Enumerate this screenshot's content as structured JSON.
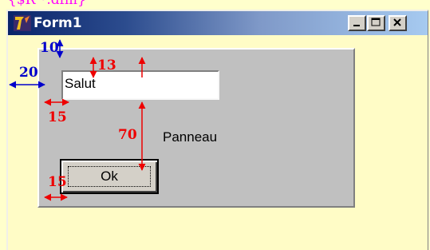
{
  "caption_top": "{$R *.dfm}",
  "window": {
    "title": "Form1",
    "icon": "delphi-app-icon",
    "controls": [
      "minimize-icon",
      "maximize-icon",
      "close-icon"
    ]
  },
  "edit": {
    "value": "Salut"
  },
  "panel": {
    "caption": "Panneau"
  },
  "ok_button": {
    "label": "Ok"
  },
  "dimensions": {
    "form_top": "10",
    "form_left": "20",
    "edit_top": "13",
    "edit_left": "15",
    "gap_edit_button": "70",
    "button_left": "15"
  },
  "colors": {
    "form_background": "#ffffcc",
    "panel_background": "#c0c0c0",
    "blue_annotation": "#0000cc",
    "red_annotation": "#ee0000"
  }
}
